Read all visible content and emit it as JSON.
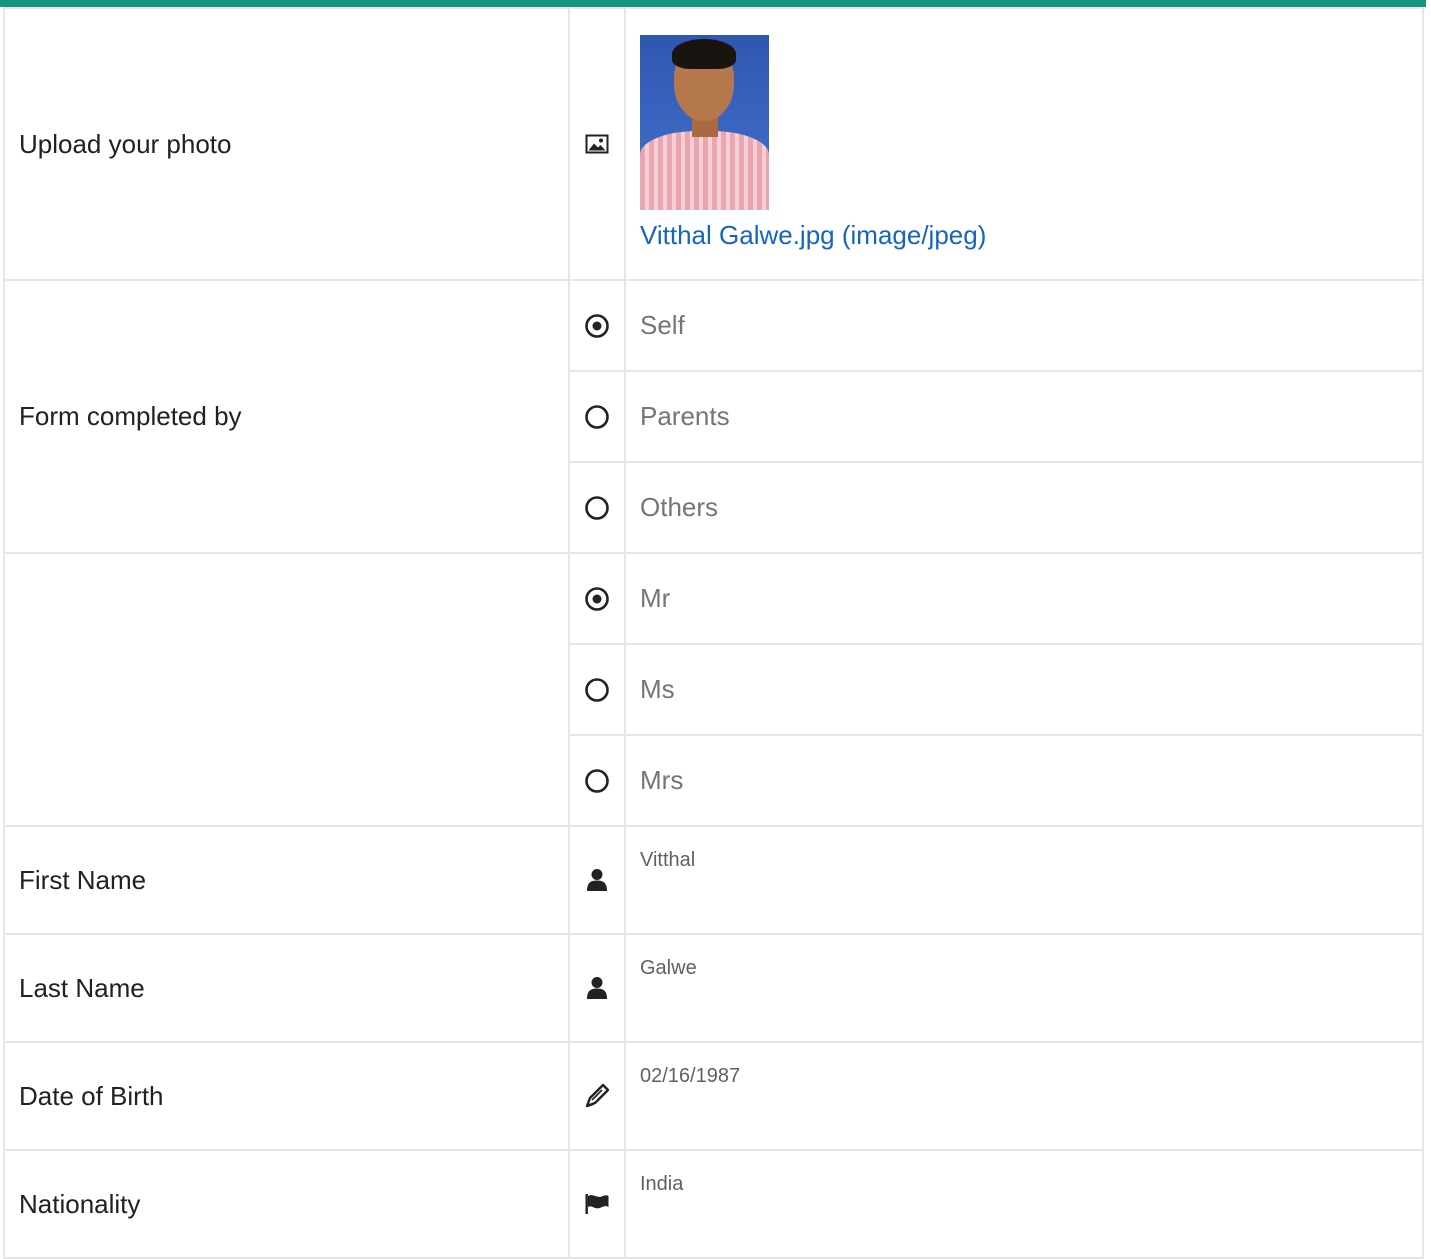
{
  "photo_field": {
    "label": "Upload your photo",
    "icon": "image-icon",
    "file_link": "Vitthal Galwe.jpg (image/jpeg)"
  },
  "form_completed_by": {
    "label": "Form completed by",
    "options": [
      {
        "label": "Self",
        "selected": true
      },
      {
        "label": "Parents",
        "selected": false
      },
      {
        "label": "Others",
        "selected": false
      }
    ]
  },
  "salutation": {
    "label": "",
    "options": [
      {
        "label": "Mr",
        "selected": true
      },
      {
        "label": "Ms",
        "selected": false
      },
      {
        "label": "Mrs",
        "selected": false
      }
    ]
  },
  "first_name": {
    "label": "First Name",
    "value": "Vitthal",
    "icon": "user-icon"
  },
  "last_name": {
    "label": "Last Name",
    "value": "Galwe",
    "icon": "user-icon"
  },
  "date_of_birth": {
    "label": "Date of Birth",
    "value": "02/16/1987",
    "icon": "pencil-icon"
  },
  "nationality": {
    "label": "Nationality",
    "value": "India",
    "icon": "flag-icon"
  },
  "colors": {
    "accent": "#16957c",
    "link": "#1565c0",
    "border": "#e6e6e6"
  }
}
